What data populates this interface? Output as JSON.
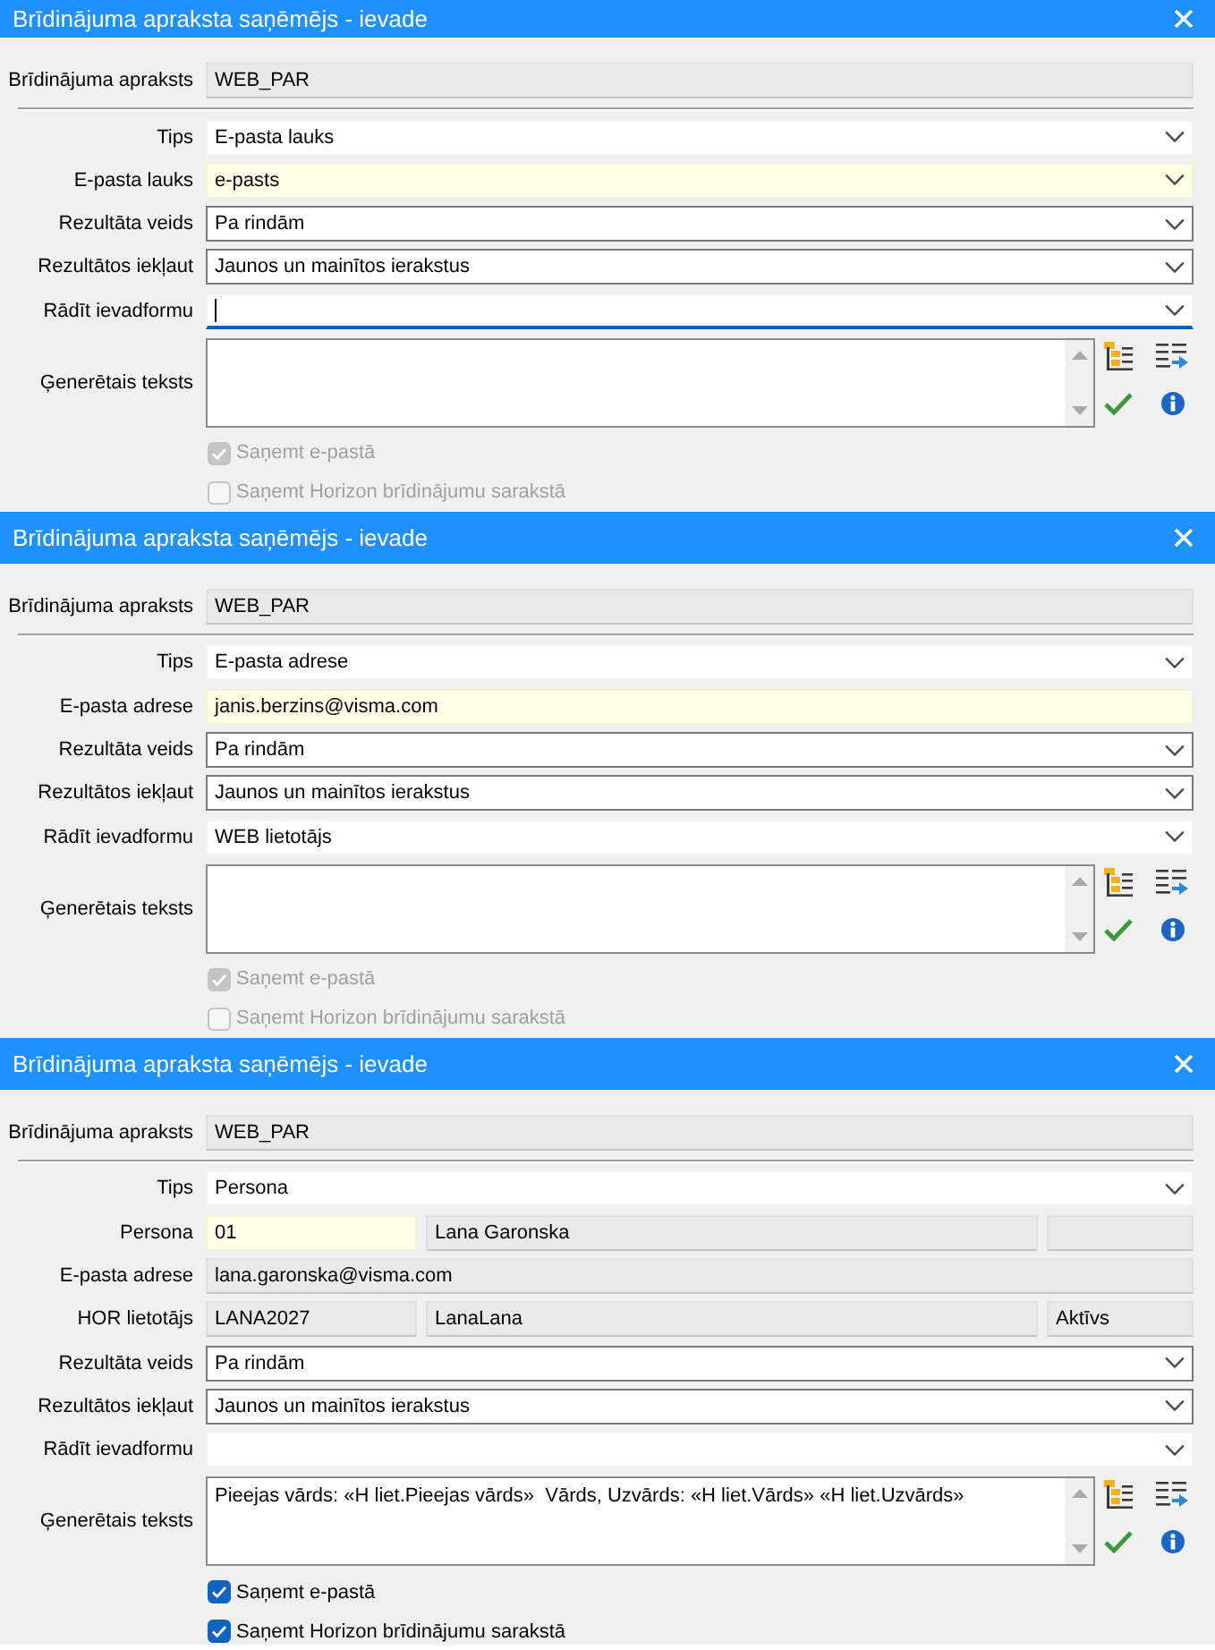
{
  "dialogs": [
    {
      "title": "Brīdinājuma apraksta saņēmējs - ievade",
      "header_row": {
        "label": "Brīdinājuma apraksts",
        "fields": [
          {
            "kind": "readonly",
            "value": "WEB_PAR",
            "required": false,
            "focused": false
          }
        ]
      },
      "rows": [
        {
          "label": "Tips",
          "fields": [
            {
              "kind": "dropdown",
              "value": "E-pasta lauks",
              "required": false,
              "focused": false
            }
          ]
        },
        {
          "label": "E-pasta lauks",
          "fields": [
            {
              "kind": "dropdown",
              "value": "e-pasts",
              "required": true,
              "focused": false
            }
          ]
        },
        {
          "label": "Rezultāta veids",
          "fields": [
            {
              "kind": "combobox",
              "value": "Pa rindām",
              "required": false,
              "focused": false
            }
          ]
        },
        {
          "label": "Rezultātos iekļaut",
          "fields": [
            {
              "kind": "combobox",
              "value": "Jaunos un mainītos ierakstus",
              "required": false,
              "focused": false
            }
          ]
        },
        {
          "label": "Rādīt ievadformu",
          "fields": [
            {
              "kind": "dropdown",
              "required": false,
              "focused": true
            }
          ]
        }
      ],
      "generated_text": {
        "label": "Ģenerētais teksts"
      },
      "checkboxes": [
        {
          "label": "Saņemt e-pastā",
          "checked": true,
          "disabled": true
        },
        {
          "label": "Saņemt Horizon brīdinājumu sarakstā",
          "checked": false,
          "disabled": true
        }
      ]
    },
    {
      "title": "Brīdinājuma apraksta saņēmējs - ievade",
      "header_row": {
        "label": "Brīdinājuma apraksts",
        "fields": [
          {
            "kind": "readonly",
            "value": "WEB_PAR",
            "required": false,
            "focused": false
          }
        ]
      },
      "rows": [
        {
          "label": "Tips",
          "fields": [
            {
              "kind": "dropdown",
              "value": "E-pasta adrese",
              "required": false,
              "focused": false
            }
          ]
        },
        {
          "label": "E-pasta adrese",
          "fields": [
            {
              "kind": "input",
              "value": "janis.berzins@visma.com",
              "required": true,
              "focused": false
            }
          ]
        },
        {
          "label": "Rezultāta veids",
          "fields": [
            {
              "kind": "combobox",
              "value": "Pa rindām",
              "required": false,
              "focused": false
            }
          ]
        },
        {
          "label": "Rezultātos iekļaut",
          "fields": [
            {
              "kind": "combobox",
              "value": "Jaunos un mainītos ierakstus",
              "required": false,
              "focused": false
            }
          ]
        },
        {
          "label": "Rādīt ievadformu",
          "fields": [
            {
              "kind": "dropdown",
              "value": "WEB lietotājs",
              "required": false,
              "focused": false
            }
          ]
        }
      ],
      "generated_text": {
        "label": "Ģenerētais teksts"
      },
      "checkboxes": [
        {
          "label": "Saņemt e-pastā",
          "checked": true,
          "disabled": true
        },
        {
          "label": "Saņemt Horizon brīdinājumu sarakstā",
          "checked": false,
          "disabled": true
        }
      ]
    },
    {
      "title": "Brīdinājuma apraksta saņēmējs - ievade",
      "header_row": {
        "label": "Brīdinājuma apraksts",
        "fields": [
          {
            "kind": "readonly",
            "value": "WEB_PAR",
            "required": false,
            "focused": false
          }
        ]
      },
      "rows": [
        {
          "label": "Tips",
          "fields": [
            {
              "kind": "dropdown",
              "value": "Persona",
              "required": false,
              "focused": false
            }
          ]
        },
        {
          "label": "Persona",
          "fields": [
            {
              "kind": "input",
              "value": "01",
              "required": true,
              "focused": false
            },
            {
              "kind": "readonly",
              "value": "Lana Garonska",
              "required": false,
              "focused": false
            },
            {
              "kind": "readonly",
              "required": false,
              "focused": false
            }
          ]
        },
        {
          "label": "E-pasta adrese",
          "fields": [
            {
              "kind": "readonly",
              "value": "lana.garonska@visma.com",
              "required": false,
              "focused": false
            }
          ]
        },
        {
          "label": "HOR lietotājs",
          "fields": [
            {
              "kind": "readonly",
              "value": "LANA2027",
              "required": false,
              "focused": false
            },
            {
              "kind": "readonly",
              "value": "LanaLana",
              "required": false,
              "focused": false
            },
            {
              "kind": "readonly",
              "value": "Aktīvs",
              "required": false,
              "focused": false
            }
          ]
        },
        {
          "label": "Rezultāta veids",
          "fields": [
            {
              "kind": "combobox",
              "value": "Pa rindām",
              "required": false,
              "focused": false
            }
          ]
        },
        {
          "label": "Rezultātos iekļaut",
          "fields": [
            {
              "kind": "combobox",
              "value": "Jaunos un mainītos ierakstus",
              "required": false,
              "focused": false
            }
          ]
        },
        {
          "label": "Rādīt ievadformu",
          "fields": [
            {
              "kind": "dropdown",
              "required": false,
              "focused": false
            }
          ]
        }
      ],
      "generated_text": {
        "label": "Ģenerētais teksts",
        "value": "Pieejas vārds: «H liet.Pieejas vārds»  Vārds, Uzvārds: «H liet.Vārds» «H liet.Uzvārds»"
      },
      "checkboxes": [
        {
          "label": "Saņemt e-pastā",
          "checked": true,
          "disabled": false
        },
        {
          "label": "Saņemt Horizon brīdinājumu sarakstā",
          "checked": true,
          "disabled": false
        }
      ]
    }
  ]
}
